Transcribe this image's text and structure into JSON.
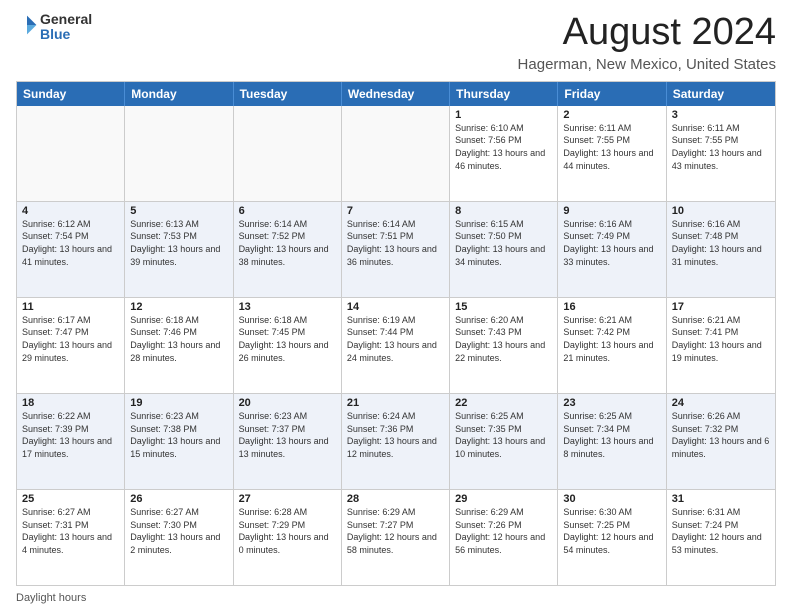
{
  "header": {
    "logo": {
      "general": "General",
      "blue": "Blue"
    },
    "title": "August 2024",
    "location": "Hagerman, New Mexico, United States"
  },
  "days_of_week": [
    "Sunday",
    "Monday",
    "Tuesday",
    "Wednesday",
    "Thursday",
    "Friday",
    "Saturday"
  ],
  "weeks": [
    {
      "cells": [
        {
          "day": "",
          "empty": true
        },
        {
          "day": "",
          "empty": true
        },
        {
          "day": "",
          "empty": true
        },
        {
          "day": "",
          "empty": true
        },
        {
          "day": "1",
          "sunrise": "6:10 AM",
          "sunset": "7:56 PM",
          "daylight": "13 hours and 46 minutes."
        },
        {
          "day": "2",
          "sunrise": "6:11 AM",
          "sunset": "7:55 PM",
          "daylight": "13 hours and 44 minutes."
        },
        {
          "day": "3",
          "sunrise": "6:11 AM",
          "sunset": "7:55 PM",
          "daylight": "13 hours and 43 minutes."
        }
      ]
    },
    {
      "cells": [
        {
          "day": "4",
          "sunrise": "6:12 AM",
          "sunset": "7:54 PM",
          "daylight": "13 hours and 41 minutes."
        },
        {
          "day": "5",
          "sunrise": "6:13 AM",
          "sunset": "7:53 PM",
          "daylight": "13 hours and 39 minutes."
        },
        {
          "day": "6",
          "sunrise": "6:14 AM",
          "sunset": "7:52 PM",
          "daylight": "13 hours and 38 minutes."
        },
        {
          "day": "7",
          "sunrise": "6:14 AM",
          "sunset": "7:51 PM",
          "daylight": "13 hours and 36 minutes."
        },
        {
          "day": "8",
          "sunrise": "6:15 AM",
          "sunset": "7:50 PM",
          "daylight": "13 hours and 34 minutes."
        },
        {
          "day": "9",
          "sunrise": "6:16 AM",
          "sunset": "7:49 PM",
          "daylight": "13 hours and 33 minutes."
        },
        {
          "day": "10",
          "sunrise": "6:16 AM",
          "sunset": "7:48 PM",
          "daylight": "13 hours and 31 minutes."
        }
      ]
    },
    {
      "cells": [
        {
          "day": "11",
          "sunrise": "6:17 AM",
          "sunset": "7:47 PM",
          "daylight": "13 hours and 29 minutes."
        },
        {
          "day": "12",
          "sunrise": "6:18 AM",
          "sunset": "7:46 PM",
          "daylight": "13 hours and 28 minutes."
        },
        {
          "day": "13",
          "sunrise": "6:18 AM",
          "sunset": "7:45 PM",
          "daylight": "13 hours and 26 minutes."
        },
        {
          "day": "14",
          "sunrise": "6:19 AM",
          "sunset": "7:44 PM",
          "daylight": "13 hours and 24 minutes."
        },
        {
          "day": "15",
          "sunrise": "6:20 AM",
          "sunset": "7:43 PM",
          "daylight": "13 hours and 22 minutes."
        },
        {
          "day": "16",
          "sunrise": "6:21 AM",
          "sunset": "7:42 PM",
          "daylight": "13 hours and 21 minutes."
        },
        {
          "day": "17",
          "sunrise": "6:21 AM",
          "sunset": "7:41 PM",
          "daylight": "13 hours and 19 minutes."
        }
      ]
    },
    {
      "cells": [
        {
          "day": "18",
          "sunrise": "6:22 AM",
          "sunset": "7:39 PM",
          "daylight": "13 hours and 17 minutes."
        },
        {
          "day": "19",
          "sunrise": "6:23 AM",
          "sunset": "7:38 PM",
          "daylight": "13 hours and 15 minutes."
        },
        {
          "day": "20",
          "sunrise": "6:23 AM",
          "sunset": "7:37 PM",
          "daylight": "13 hours and 13 minutes."
        },
        {
          "day": "21",
          "sunrise": "6:24 AM",
          "sunset": "7:36 PM",
          "daylight": "13 hours and 12 minutes."
        },
        {
          "day": "22",
          "sunrise": "6:25 AM",
          "sunset": "7:35 PM",
          "daylight": "13 hours and 10 minutes."
        },
        {
          "day": "23",
          "sunrise": "6:25 AM",
          "sunset": "7:34 PM",
          "daylight": "13 hours and 8 minutes."
        },
        {
          "day": "24",
          "sunrise": "6:26 AM",
          "sunset": "7:32 PM",
          "daylight": "13 hours and 6 minutes."
        }
      ]
    },
    {
      "cells": [
        {
          "day": "25",
          "sunrise": "6:27 AM",
          "sunset": "7:31 PM",
          "daylight": "13 hours and 4 minutes."
        },
        {
          "day": "26",
          "sunrise": "6:27 AM",
          "sunset": "7:30 PM",
          "daylight": "13 hours and 2 minutes."
        },
        {
          "day": "27",
          "sunrise": "6:28 AM",
          "sunset": "7:29 PM",
          "daylight": "13 hours and 0 minutes."
        },
        {
          "day": "28",
          "sunrise": "6:29 AM",
          "sunset": "7:27 PM",
          "daylight": "12 hours and 58 minutes."
        },
        {
          "day": "29",
          "sunrise": "6:29 AM",
          "sunset": "7:26 PM",
          "daylight": "12 hours and 56 minutes."
        },
        {
          "day": "30",
          "sunrise": "6:30 AM",
          "sunset": "7:25 PM",
          "daylight": "12 hours and 54 minutes."
        },
        {
          "day": "31",
          "sunrise": "6:31 AM",
          "sunset": "7:24 PM",
          "daylight": "12 hours and 53 minutes."
        }
      ]
    }
  ],
  "footer": {
    "daylight_label": "Daylight hours"
  }
}
